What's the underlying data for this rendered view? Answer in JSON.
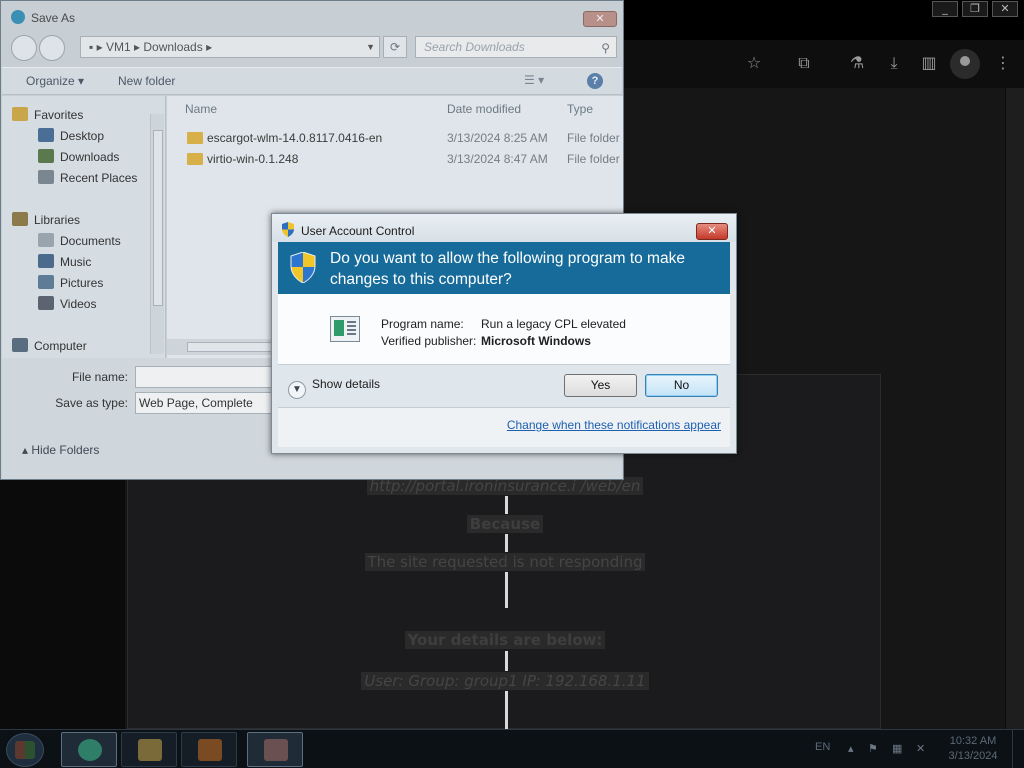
{
  "browser": {
    "window_buttons": [
      "_",
      "❐",
      "✕"
    ],
    "page_lines": [
      {
        "text": "http://portal.ironinsurance.i /web/en",
        "style": "ital"
      },
      {
        "text": "Because",
        "style": "bold"
      },
      {
        "text": "The site requested is not responding",
        "style": "plain"
      },
      {
        "text": "Your details are below:",
        "style": "bold"
      },
      {
        "text": "User:    Group: group1   IP: 192.168.1.11",
        "style": "ital"
      }
    ]
  },
  "save_as": {
    "title": "Save As",
    "address": {
      "crumbs": [
        "VM1",
        "Downloads"
      ]
    },
    "search_placeholder": "Search Downloads",
    "toolbar": {
      "organize": "Organize",
      "new_folder": "New folder"
    },
    "nav": {
      "favorites": {
        "label": "Favorites",
        "items": [
          "Desktop",
          "Downloads",
          "Recent Places"
        ]
      },
      "libraries": {
        "label": "Libraries",
        "items": [
          "Documents",
          "Music",
          "Pictures",
          "Videos"
        ]
      },
      "computer": "Computer"
    },
    "columns": {
      "name": "Name",
      "date": "Date modified",
      "type": "Type"
    },
    "files": [
      {
        "name": "escargot-wlm-14.0.8117.0416-en",
        "date": "3/13/2024 8:25 AM",
        "type": "File folder"
      },
      {
        "name": "virtio-win-0.1.248",
        "date": "3/13/2024 8:47 AM",
        "type": "File folder"
      }
    ],
    "form": {
      "file_name_label": "File name:",
      "file_name_value": "",
      "save_as_type_label": "Save as type:",
      "save_as_type_value": "Web Page, Complete",
      "hide_folders": "Hide Folders"
    }
  },
  "uac": {
    "title": "User Account Control",
    "question": "Do you want to allow the following program to make changes to this computer?",
    "program_name_label": "Program name:",
    "program_name_value": "Run a legacy CPL elevated",
    "publisher_label": "Verified publisher:",
    "publisher_value": "Microsoft Windows",
    "show_details": "Show details",
    "yes": "Yes",
    "no": "No",
    "change_link": "Change when these notifications appear",
    "colors": {
      "banner": "#166b9a",
      "link": "#1f5fb0"
    }
  },
  "taskbar": {
    "language": "EN",
    "time": "10:32 AM",
    "date": "3/13/2024"
  }
}
